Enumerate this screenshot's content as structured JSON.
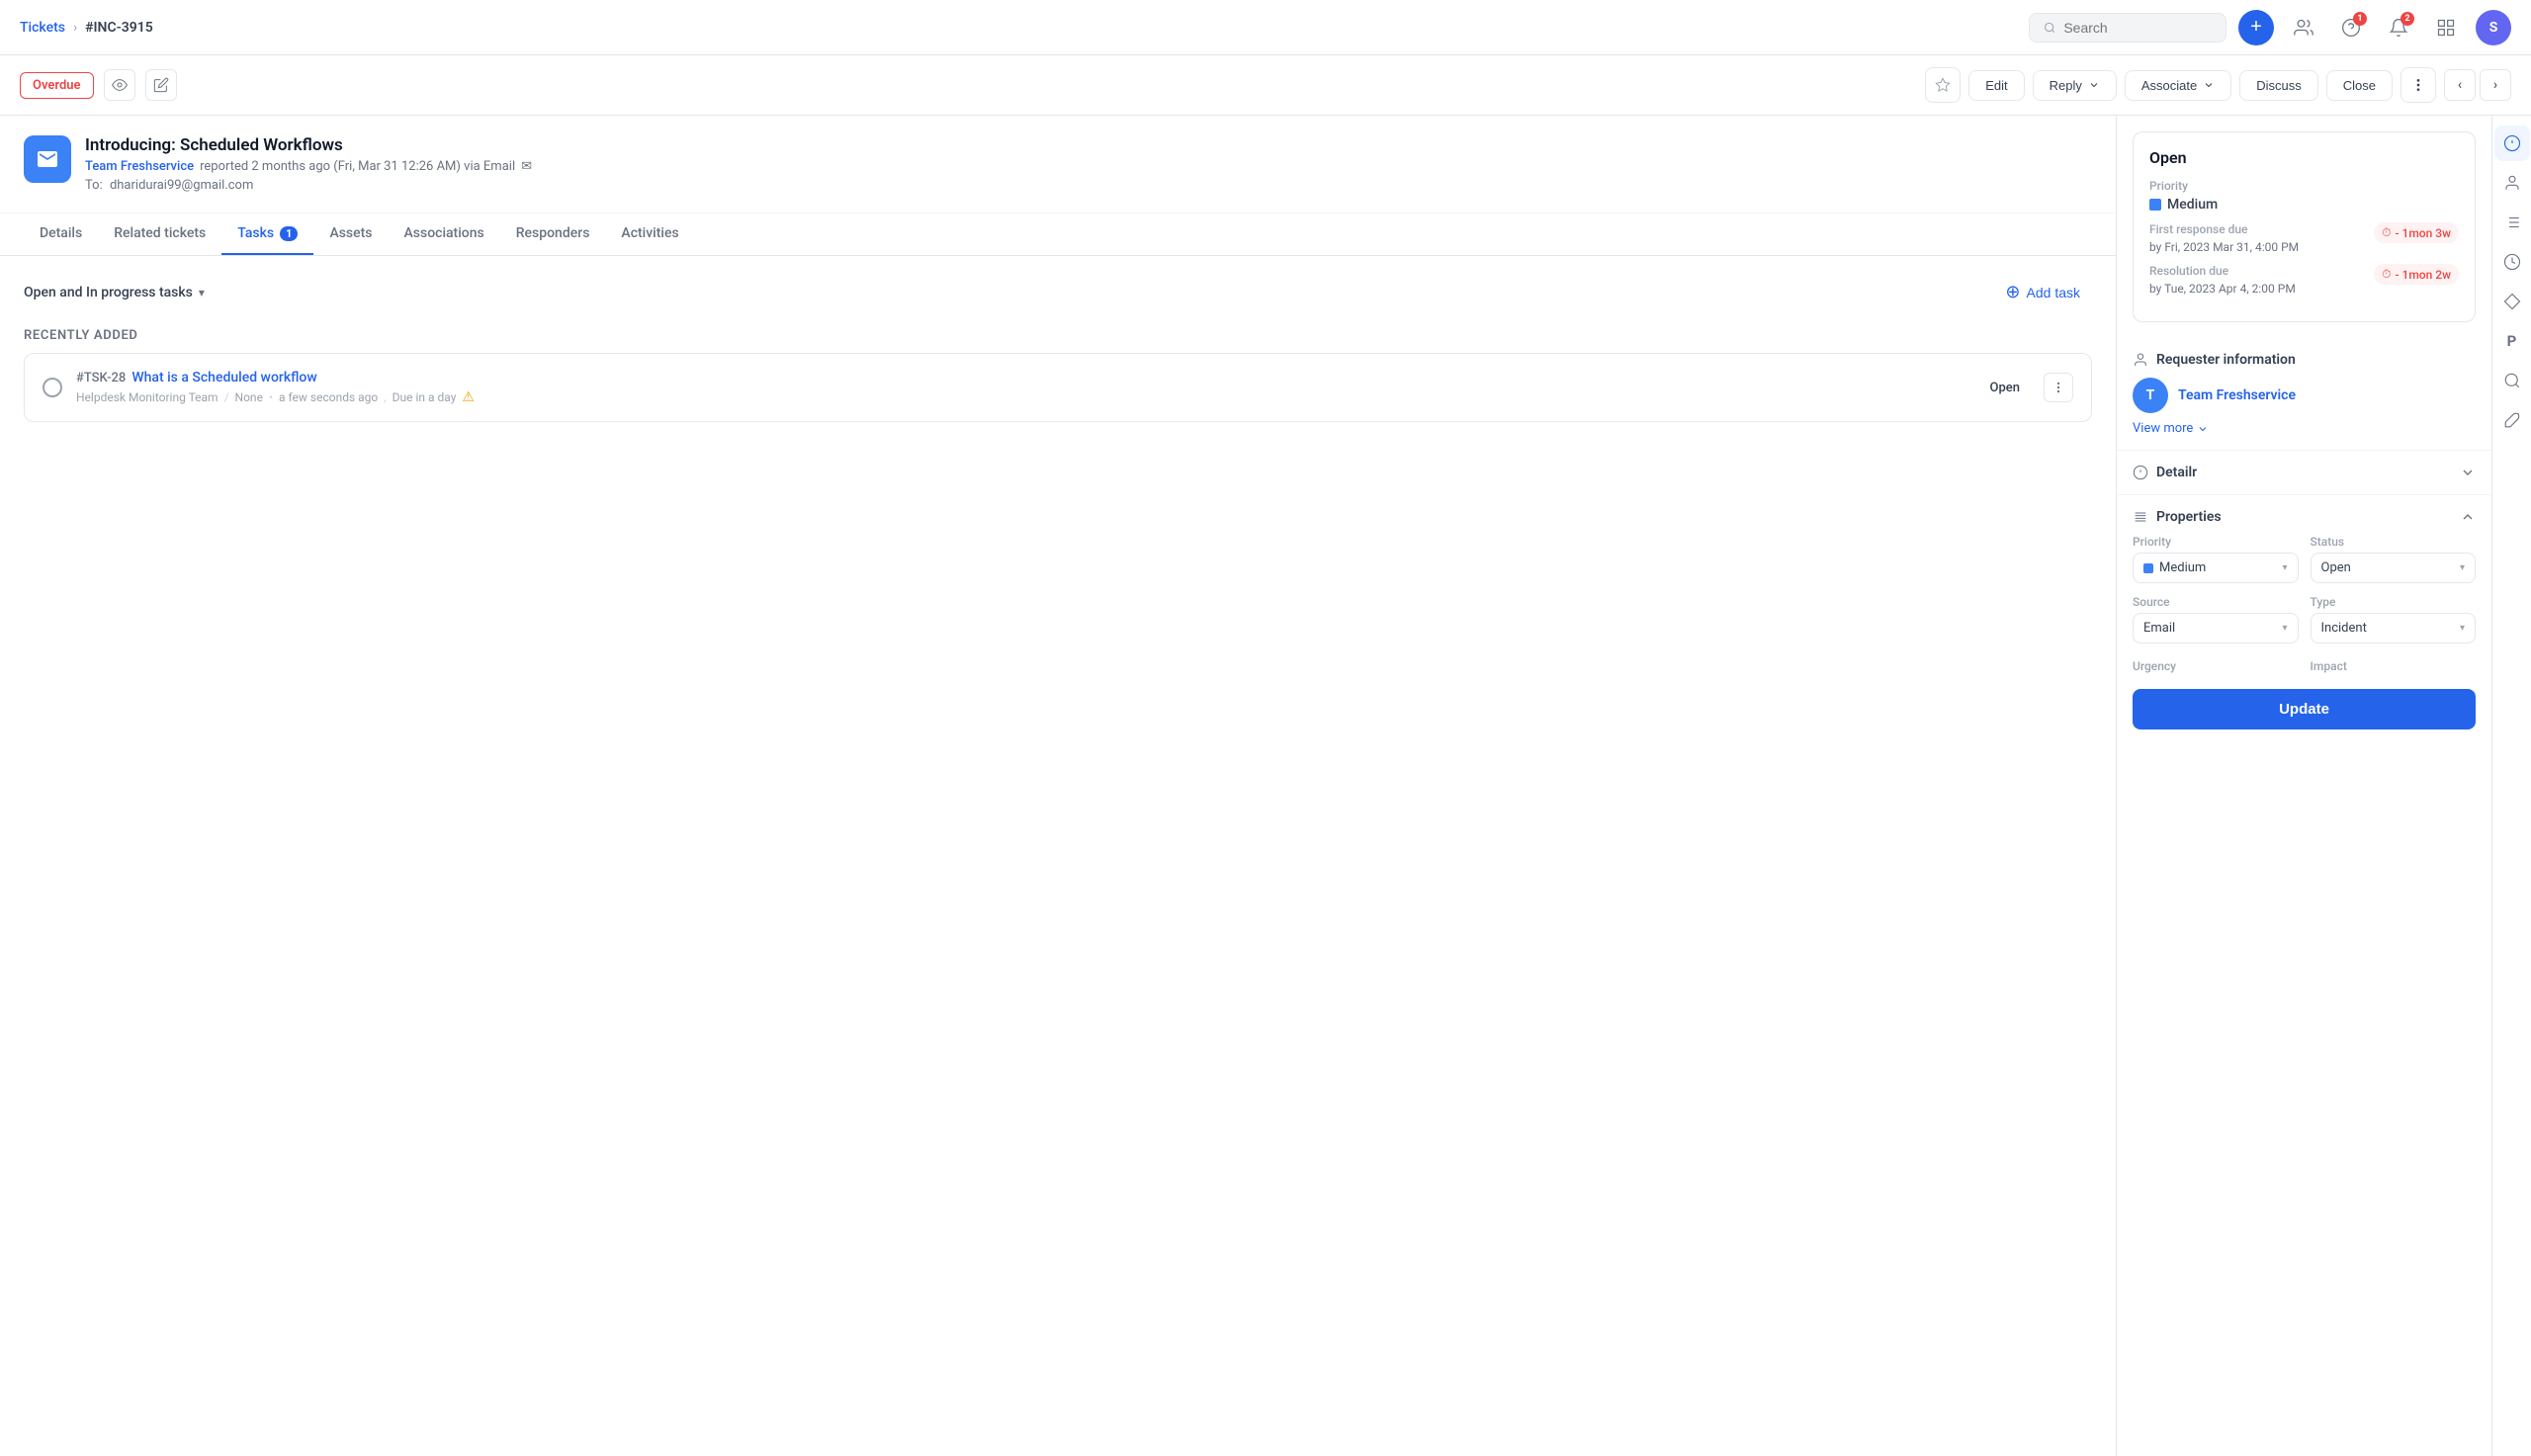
{
  "topbar": {
    "breadcrumb_tickets": "Tickets",
    "breadcrumb_sep": ">",
    "breadcrumb_current": "#INC-3915",
    "search_placeholder": "Search",
    "plus_icon": "+",
    "notifications_badge": "2",
    "help_badge": "1",
    "avatar_label": "S"
  },
  "toolbar": {
    "overdue_label": "Overdue",
    "edit_label": "Edit",
    "reply_label": "Reply",
    "associate_label": "Associate",
    "discuss_label": "Discuss",
    "close_label": "Close",
    "star_icon": "☆",
    "more_icon": "⋯",
    "prev_icon": "‹",
    "next_icon": "›"
  },
  "ticket": {
    "title": "Introducing: Scheduled Workflows",
    "reporter": "Team Freshservice",
    "reported_time": "reported 2 months ago (Fri, Mar 31 12:26 AM) via Email",
    "email_icon": "✉",
    "to_label": "To:",
    "to_email": "dharidurai99@gmail.com"
  },
  "tabs": [
    {
      "id": "details",
      "label": "Details",
      "active": false
    },
    {
      "id": "related-tickets",
      "label": "Related tickets",
      "active": false
    },
    {
      "id": "tasks",
      "label": "Tasks",
      "active": true,
      "badge": "1"
    },
    {
      "id": "assets",
      "label": "Assets",
      "active": false
    },
    {
      "id": "associations",
      "label": "Associations",
      "active": false
    },
    {
      "id": "responders",
      "label": "Responders",
      "active": false
    },
    {
      "id": "activities",
      "label": "Activities",
      "active": false
    }
  ],
  "tasks": {
    "filter_label": "Open and In progress tasks",
    "add_task_label": "Add task",
    "recently_added_label": "Recently Added",
    "task": {
      "id": "#TSK-28",
      "name": "What is a Scheduled workflow",
      "team": "Helpdesk Monitoring Team",
      "assignee": "None",
      "time": "a few seconds ago",
      "due": "Due in a day",
      "status": "Open"
    }
  },
  "status_card": {
    "title": "Open",
    "priority_label": "Priority",
    "priority_value": "Medium",
    "first_response_label": "First response due",
    "first_response_date": "by Fri, 2023 Mar 31, 4:00 PM",
    "first_response_overdue": "- 1mon 3w",
    "resolution_label": "Resolution due",
    "resolution_date": "by Tue, 2023 Apr 4, 2:00 PM",
    "resolution_overdue": "- 1mon 2w"
  },
  "requester": {
    "section_title": "Requester information",
    "avatar_label": "T",
    "name": "Team Freshservice",
    "view_more": "View more"
  },
  "details": {
    "section_title": "Detailr"
  },
  "properties": {
    "section_title": "Properties",
    "priority_label": "Priority",
    "priority_value": "Medium",
    "status_label": "Status",
    "status_value": "Open",
    "source_label": "Source",
    "source_value": "Email",
    "type_label": "Type",
    "type_value": "Incident",
    "urgency_label": "Urgency",
    "impact_label": "Impact",
    "update_btn": "Update"
  },
  "right_sidebar_icons": [
    {
      "name": "info-icon",
      "symbol": "ℹ",
      "active": true
    },
    {
      "name": "person-icon",
      "symbol": "👤",
      "active": false
    },
    {
      "name": "list-icon",
      "symbol": "☰",
      "active": false
    },
    {
      "name": "clock-icon",
      "symbol": "◷",
      "active": false
    },
    {
      "name": "diamond-icon",
      "symbol": "◈",
      "active": false
    },
    {
      "name": "p-icon",
      "symbol": "P",
      "active": false
    },
    {
      "name": "search-icon",
      "symbol": "⊕",
      "active": false
    },
    {
      "name": "brush-icon",
      "symbol": "✏",
      "active": false
    }
  ]
}
